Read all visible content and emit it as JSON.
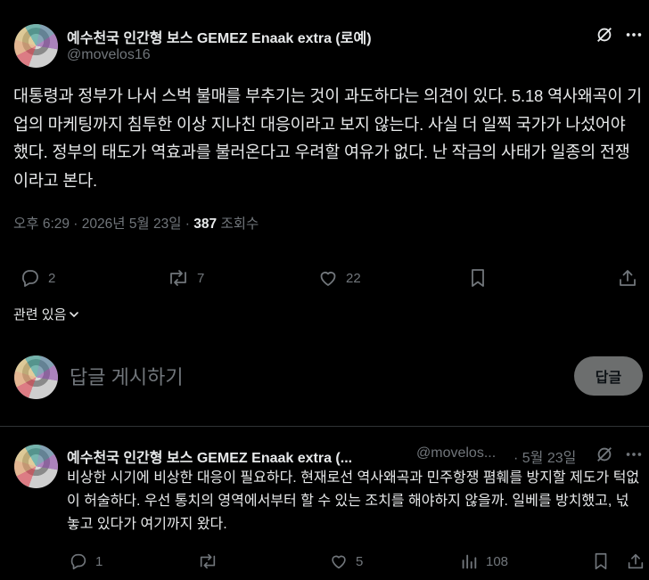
{
  "post": {
    "author_name": "예수천국 인간형 보스 GEMEZ Enaak extra (로예)",
    "handle": "@movelos16",
    "body": "대통령과 정부가 나서 스벅 불매를 부추기는 것이 과도하다는 의견이 있다. 5.18 역사왜곡이 기업의 마케팅까지 침투한 이상 지나친 대응이라고 보지 않는다. 사실 더 일찍 국가가 나섰어야 했다. 정부의 태도가 역효과를 불러온다고 우려할 여유가 없다. 난 작금의 사태가 일종의 전쟁이라고 본다.",
    "timestamp": "오후 6:29 · 2026년 5월 23일 · ",
    "views_count": "387",
    "views_label": " 조회수",
    "stats": {
      "replies": "2",
      "reposts": "7",
      "likes": "22"
    },
    "related_label": "관련 있음"
  },
  "composer": {
    "placeholder": "답글 게시하기",
    "button_label": "답글"
  },
  "reply": {
    "author_name": "예수천국 인간형 보스 GEMEZ Enaak extra (...",
    "handle": "@movelos...",
    "date": "· 5월 23일",
    "body": "비상한 시기에 비상한 대응이 필요하다. 현재로선 역사왜곡과 민주항쟁 폄훼를 방지할 제도가 턱없이 허술하다. 우선 통치의 영역에서부터 할 수 있는 조치를 해야하지 않을까. 일베를 방치했고, 넋놓고 있다가 여기까지 왔다.",
    "stats": {
      "replies": "1",
      "reposts": "",
      "likes": "5",
      "views": "108"
    }
  },
  "icons": [
    "grok-icon",
    "more-icon",
    "reply-icon",
    "repost-icon",
    "like-icon",
    "bookmark-icon",
    "share-icon",
    "chevron-down-icon",
    "views-icon"
  ],
  "colors": {
    "background": "#000000",
    "text": "#e7e9ea",
    "muted": "#71767b",
    "divider": "#2f3336",
    "button": "#787a7a"
  }
}
